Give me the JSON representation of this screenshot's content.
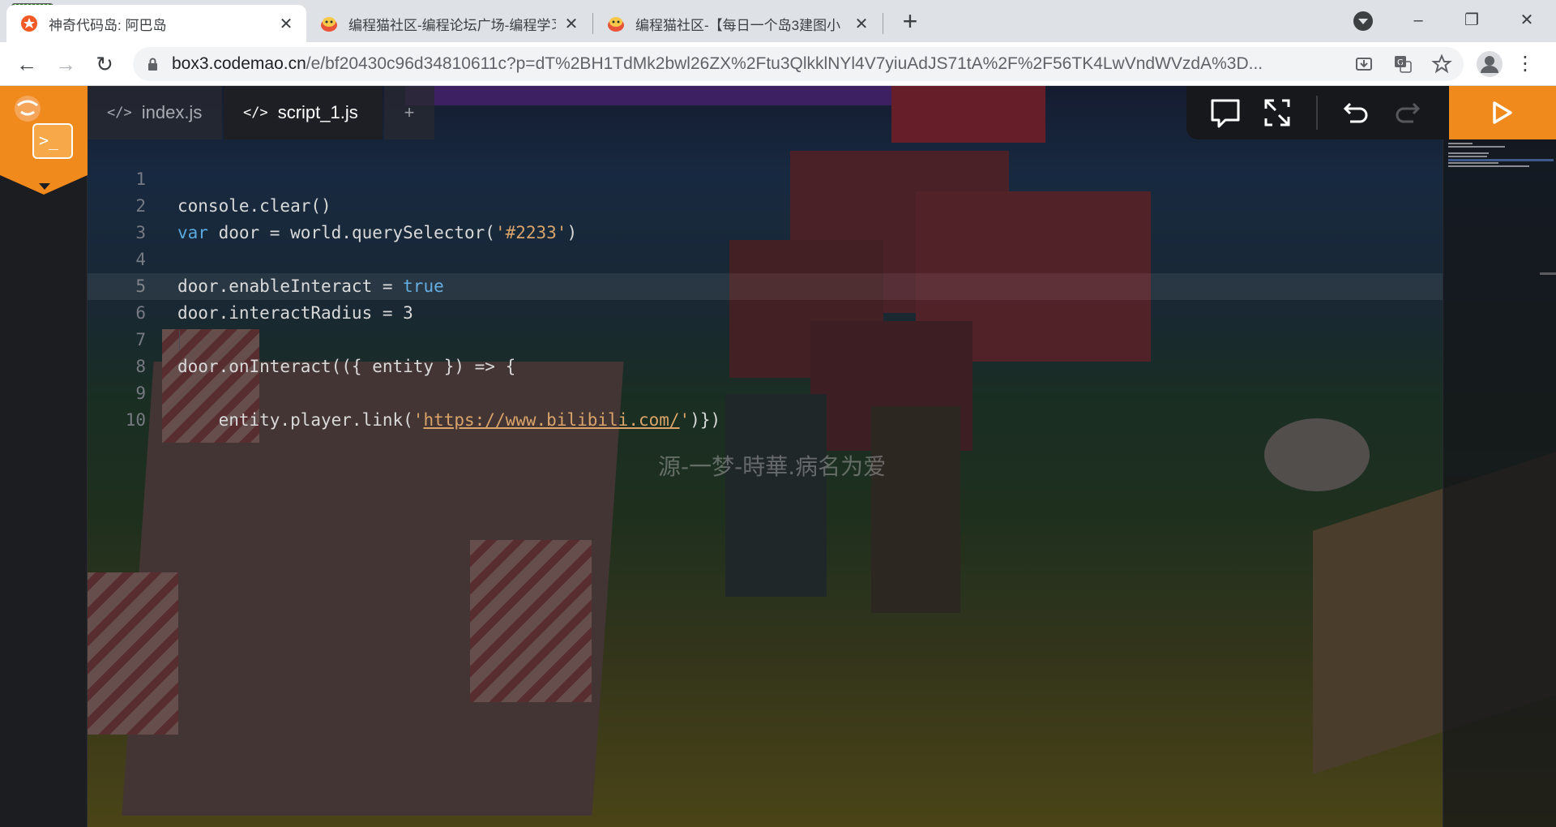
{
  "browser": {
    "tabs": [
      {
        "title": "神奇代码岛: 阿巴岛",
        "active": true
      },
      {
        "title": "编程猫社区-编程论坛广场-编程学习交流",
        "active": false
      },
      {
        "title": "编程猫社区-【每日一个岛3建图小",
        "active": false
      }
    ],
    "url_host": "box3.codemao.cn",
    "url_rest": "/e/bf20430c96d34810611c?p=dT%2BH1TdMk2bwl26ZX%2Ftu3QlkklNYl4V7yiuAdJS71tA%2F%2F56TK4LwVndWVzdA%3D..."
  },
  "editor": {
    "tabs": [
      {
        "label": "index.js",
        "icon": "code-icon"
      },
      {
        "label": "script_1.js",
        "icon": "code-icon"
      }
    ],
    "add_tab": "+",
    "current_line": 6,
    "lines": [
      {
        "n": "1"
      },
      {
        "n": "2"
      },
      {
        "n": "3"
      },
      {
        "n": "4"
      },
      {
        "n": "5"
      },
      {
        "n": "6"
      },
      {
        "n": "7"
      },
      {
        "n": "8"
      },
      {
        "n": "9"
      },
      {
        "n": "10"
      }
    ],
    "code": {
      "l1": "console.clear()",
      "l2_kw": "var",
      "l2_a": " door = world.querySelector(",
      "l2_str": "'#2233'",
      "l2_b": ")",
      "l4_a": "door.enableInteract = ",
      "l4_kw": "true",
      "l5": "door.interactRadius = 3",
      "l7": "door.onInteract(({ entity }) => {",
      "l8_a": "    entity.player.link(",
      "l8_q1": "'",
      "l8_url": "https://www.bilibili.com/",
      "l8_q2": "'",
      "l8_b": ")})"
    }
  },
  "scene": {
    "watermark": "源-一梦-時華.病名为爱"
  },
  "colors": {
    "accent": "#f08a1c",
    "editor_bg": "#1e1f24",
    "keyword": "#5aa8e0",
    "string": "#d9a36a"
  }
}
